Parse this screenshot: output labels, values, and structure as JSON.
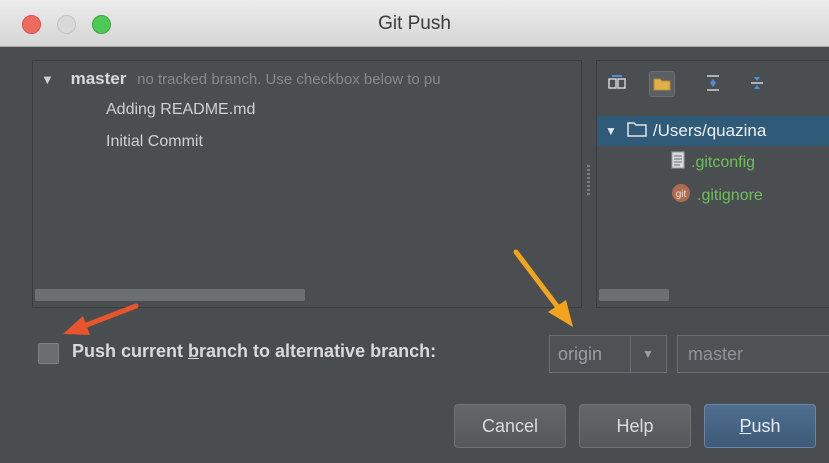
{
  "window": {
    "title": "Git Push"
  },
  "commits": {
    "branch": "master",
    "branch_hint": "no tracked branch. Use checkbox below to pu",
    "items": [
      "Adding README.md",
      "Initial Commit"
    ]
  },
  "files": {
    "root": "/Users/quazina",
    "items": [
      ".gitconfig",
      ".gitignore"
    ]
  },
  "options": {
    "push_label_prefix": "Push current ",
    "push_label_mnemonic": "b",
    "push_label_rest": "ranch to alternative branch:",
    "remote": "origin",
    "target_branch": "master"
  },
  "buttons": {
    "cancel": "Cancel",
    "help": "Help",
    "push_mnemonic": "P",
    "push_rest": "ush"
  },
  "colors": {
    "accent_arrow_orange": "#f2a41e",
    "accent_arrow_red": "#e8542c"
  }
}
